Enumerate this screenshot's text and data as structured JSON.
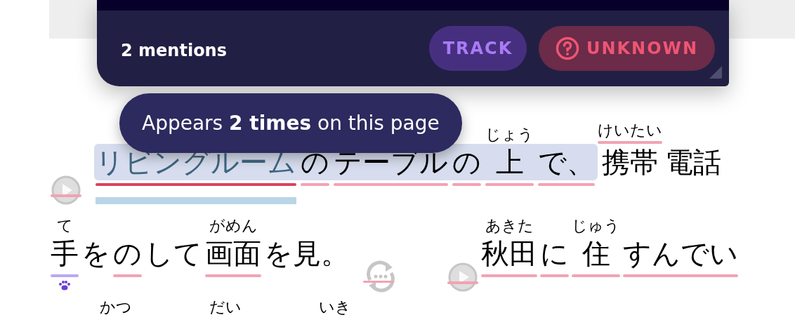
{
  "popup": {
    "mentions": "2 mentions",
    "buttons": [
      {
        "kind": "track",
        "label": "TRACK"
      },
      {
        "kind": "unknown",
        "label": "UNKNOWN"
      }
    ]
  },
  "tooltip": {
    "text": "Appears **2 times** on this page"
  },
  "lines": [
    {
      "items": [
        {
          "kind": "play",
          "color": "#f2a3b3"
        },
        {
          "kind": "phrase",
          "tokens": [
            {
              "text": "リビングルーム",
              "color": "#d9435e",
              "selected": true
            },
            {
              "text": "の",
              "color": "#f2a3b3",
              "selected": false
            },
            {
              "text": "テーブル",
              "color": "#f2a3b3",
              "selected": false
            },
            {
              "text": "の",
              "color": "#f2a3b3",
              "selected": false
            },
            {
              "text": "上",
              "ruby": "じょう",
              "color": "#f2a3b3",
              "selected": false
            },
            {
              "text": "で、",
              "color": "#f2a3b3",
              "selected": false
            }
          ]
        },
        {
          "kind": "token",
          "text": "携帯",
          "ruby": "けいたい",
          "ruby_underlined": true,
          "selected": false
        },
        {
          "kind": "token",
          "text": "電話",
          "selected": false
        }
      ]
    },
    {
      "items": [
        {
          "kind": "token",
          "text": "手",
          "ruby": "て",
          "color": "#b9a7f7",
          "paw": true,
          "selected": false
        },
        {
          "kind": "token",
          "text": "を",
          "selected": false
        },
        {
          "kind": "token",
          "text": "の",
          "color": "#f2a3b3",
          "selected": false
        },
        {
          "kind": "token",
          "text": "して",
          "selected": false
        },
        {
          "kind": "token",
          "text": "画面",
          "ruby": "がめん",
          "color": "#f2a3b3",
          "selected": false
        },
        {
          "kind": "token",
          "text": "を見。",
          "selected": false
        },
        {
          "kind": "replay",
          "color": "#f2a3b3"
        },
        {
          "kind": "play",
          "color": "#f2a3b3"
        },
        {
          "kind": "token",
          "text": "秋田",
          "ruby": "あきた",
          "color": "#f2a3b3",
          "selected": false
        },
        {
          "kind": "token",
          "text": "に",
          "color": "#f2a3b3",
          "selected": false
        },
        {
          "kind": "token",
          "text": "住",
          "ruby": "じゅう",
          "color": "#f2a3b3",
          "selected": false
        },
        {
          "kind": "token",
          "text": "すんでい",
          "color": "#f2a3b3",
          "selected": false
        }
      ]
    }
  ],
  "next_line_furigana": [
    "かつ",
    "だい",
    "いき"
  ]
}
